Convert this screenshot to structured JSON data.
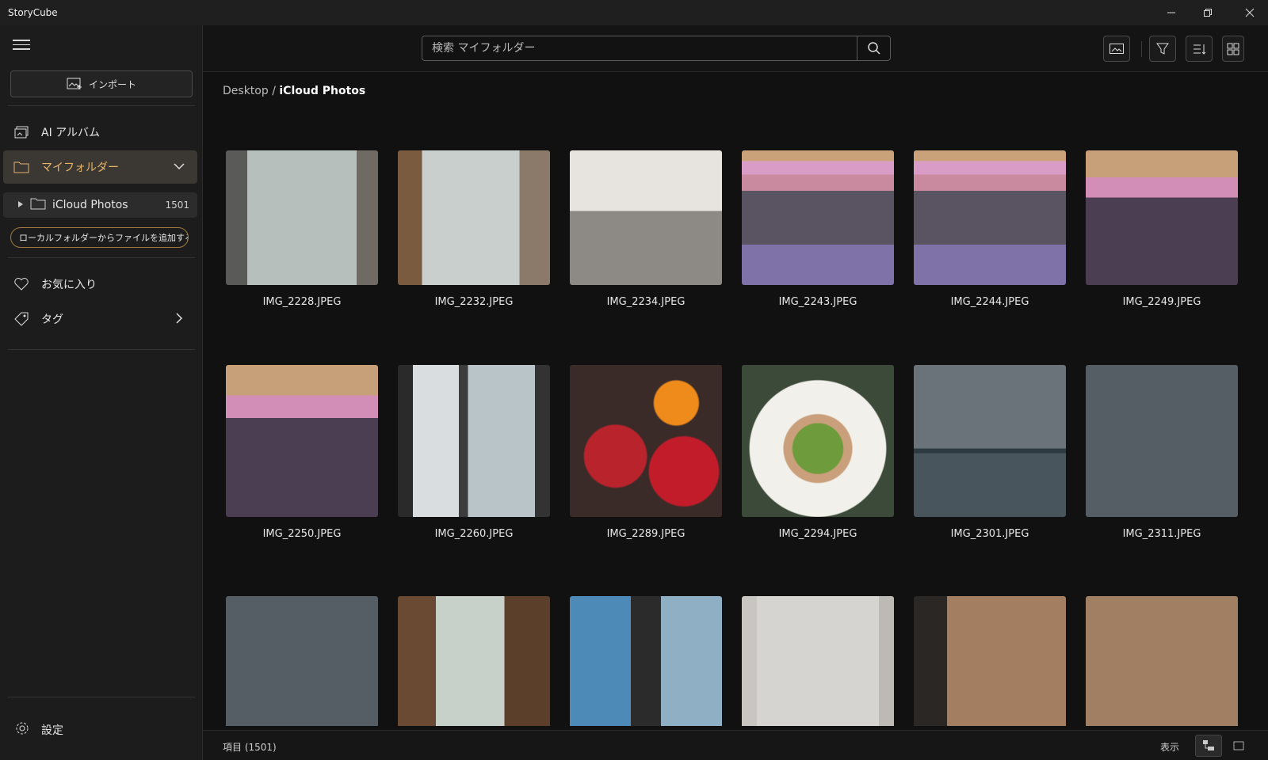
{
  "app": {
    "title": "StoryCube"
  },
  "sidebar": {
    "import_label": "インポート",
    "items": [
      {
        "label": "AI アルバム",
        "icon": "ai-album-icon"
      },
      {
        "label": "マイフォルダー",
        "icon": "folder-icon"
      },
      {
        "label": "お気に入り",
        "icon": "heart-icon"
      },
      {
        "label": "タグ",
        "icon": "tag-icon"
      }
    ],
    "folder": {
      "name": "iCloud Photos",
      "count": "1501"
    },
    "add_local_label": "ローカルフォルダーからファイルを追加する",
    "settings_label": "設定"
  },
  "search": {
    "placeholder": "検索 マイフォルダー"
  },
  "breadcrumb": {
    "root": "Desktop",
    "separator": "/",
    "current": "iCloud Photos"
  },
  "photos": [
    {
      "name": "IMG_2228.JPEG"
    },
    {
      "name": "IMG_2232.JPEG"
    },
    {
      "name": "IMG_2234.JPEG"
    },
    {
      "name": "IMG_2243.JPEG"
    },
    {
      "name": "IMG_2244.JPEG"
    },
    {
      "name": "IMG_2249.JPEG"
    },
    {
      "name": "IMG_2250.JPEG"
    },
    {
      "name": "IMG_2260.JPEG"
    },
    {
      "name": "IMG_2289.JPEG"
    },
    {
      "name": "IMG_2294.JPEG"
    },
    {
      "name": "IMG_2301.JPEG"
    },
    {
      "name": "IMG_2311.JPEG"
    },
    {
      "name": ""
    },
    {
      "name": ""
    },
    {
      "name": ""
    },
    {
      "name": ""
    },
    {
      "name": ""
    },
    {
      "name": ""
    }
  ],
  "status": {
    "count_label": "項目 (1501)",
    "view_label": "表示"
  },
  "colors": {
    "accent": "#a07840",
    "active_nav": "#3b3833",
    "background": "#111111"
  }
}
